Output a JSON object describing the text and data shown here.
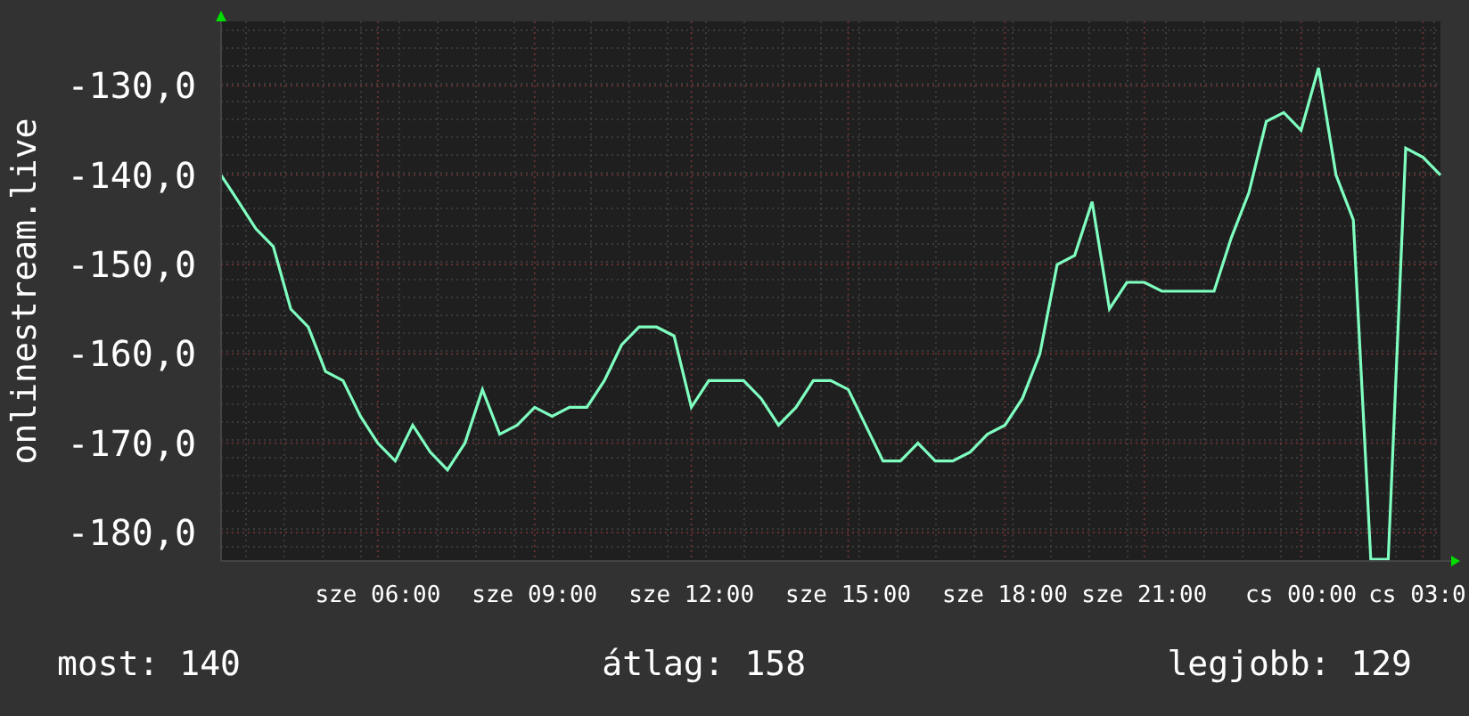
{
  "chart": {
    "chart_data": {
      "type": "line",
      "ylabel": "onlinestream.live",
      "ylim": [
        -183.2,
        -122.8
      ],
      "grid": true,
      "yticks": [
        {
          "value": -130,
          "label": "-130,0"
        },
        {
          "value": -140,
          "label": "-140,0"
        },
        {
          "value": -150,
          "label": "-150,0"
        },
        {
          "value": -160,
          "label": "-160,0"
        },
        {
          "value": -170,
          "label": "-170,0"
        },
        {
          "value": -180,
          "label": "-180,0"
        }
      ],
      "categories": [
        null,
        null,
        null,
        null,
        null,
        null,
        null,
        null,
        null,
        "sze 06:00",
        null,
        null,
        null,
        null,
        null,
        null,
        null,
        null,
        "sze 09:00",
        null,
        null,
        null,
        null,
        null,
        null,
        null,
        null,
        "sze 12:00",
        null,
        null,
        null,
        null,
        null,
        null,
        null,
        null,
        "sze 15:00",
        null,
        null,
        null,
        null,
        null,
        null,
        null,
        null,
        "sze 18:00",
        null,
        null,
        null,
        null,
        null,
        null,
        null,
        "sze 21:00",
        null,
        null,
        null,
        null,
        null,
        null,
        null,
        null,
        "cs 00:00",
        null,
        null,
        null,
        null,
        null,
        null,
        "cs 03:0",
        null
      ],
      "series": [
        {
          "color": "#7fffc0",
          "values": [
            -140,
            -143,
            -146,
            -148,
            -155,
            -157,
            -162,
            -163,
            -167,
            -170,
            -172,
            -168,
            -171,
            -173,
            -170,
            -164,
            -169,
            -168,
            -166,
            -167,
            -166,
            -166,
            -163,
            -159,
            -157,
            -157,
            -158,
            -166,
            -163,
            -163,
            -163,
            -165,
            -168,
            -166,
            -163,
            -163,
            -164,
            -168,
            -172,
            -172,
            -170,
            -172,
            -172,
            -171,
            -169,
            -168,
            -165,
            -160,
            -150,
            -149,
            -143,
            -155,
            -152,
            -152,
            -153,
            -153,
            -153,
            -153,
            -147,
            -142,
            -134,
            -133,
            -135,
            -128,
            -140,
            -145,
            -183,
            -183,
            -137,
            -138,
            -140
          ]
        }
      ]
    }
  },
  "legend": [
    {
      "label": "most: 140"
    },
    {
      "label": "átlag: 158"
    },
    {
      "label": "legjobb: 129"
    }
  ]
}
